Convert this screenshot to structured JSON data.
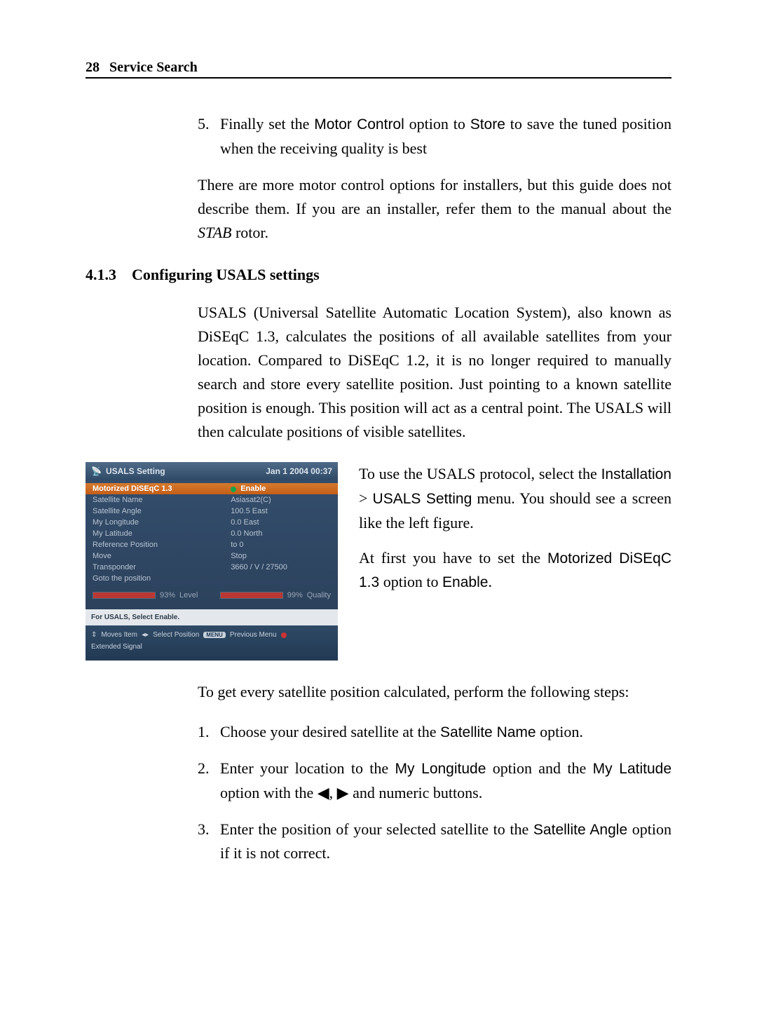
{
  "header": {
    "page_number": "28",
    "running_head": "Service Search"
  },
  "intro_list": {
    "item5_num": "5.",
    "item5_a": "Finally set the ",
    "item5_motor": "Motor Control",
    "item5_b": " option to ",
    "item5_store": "Store",
    "item5_c": " to save the tuned position when the receiving quality is best"
  },
  "para1_a": "There are more motor control options for installers, but this guide does not describe them. If you are an installer, refer them to the manual about the ",
  "para1_stab": "STAB",
  "para1_b": " rotor.",
  "section": {
    "num": "4.1.3",
    "title": "Configuring USALS settings"
  },
  "para2": "USALS (Universal Satellite Automatic Location System), also known as DiSEqC 1.3, calculates the positions of all available satellites from your location. Compared to DiSEqC 1.2, it is no longer required to manually search and store every satellite position. Just pointing to a known satellite position is enough. This position will act as a central point. The USALS will then calculate positions of visible satellites.",
  "side": {
    "p1_a": "To use the USALS protocol, select the ",
    "p1_install": "Installation",
    "p1_gt": " > ",
    "p1_usals": "USALS Setting",
    "p1_b": " menu. You should see a screen like the left figure.",
    "p2_a": "At first you have to set the ",
    "p2_opt": "Motorized DiSEqC 1.3",
    "p2_b": " option to ",
    "p2_en": "Enable",
    "p2_c": "."
  },
  "ui": {
    "title": "USALS Setting",
    "date": "Jan 1 2004 00:37",
    "rows": [
      {
        "label": "Motorized DiSEqC 1.3",
        "value": "Enable",
        "highlight": true,
        "dot": true
      },
      {
        "label": "Satellite Name",
        "value": "Asiasat2(C)"
      },
      {
        "label": "Satellite Angle",
        "value": "100.5 East"
      },
      {
        "label": "My Longitude",
        "value": "0.0 East"
      },
      {
        "label": "My Latitude",
        "value": "0.0 North"
      },
      {
        "label": "Reference Position",
        "value": "to 0"
      },
      {
        "label": "Move",
        "value": "Stop"
      },
      {
        "label": "Transponder",
        "value": "3660 / V / 27500"
      },
      {
        "label": "Goto the position",
        "value": ""
      }
    ],
    "meter1_pct": "93%",
    "meter1_lab": "Level",
    "meter2_pct": "99%",
    "meter2_lab": "Quality",
    "help": "For USALS, Select Enable.",
    "foot_updown": "Moves Item",
    "foot_lr": "Select Position",
    "foot_menu_pill": "MENU",
    "foot_menu": "Previous Menu",
    "foot_ext": "Extended Signal"
  },
  "para3": "To get every satellite position calculated, perform the following steps:",
  "steps": {
    "s1_num": "1.",
    "s1_a": "Choose your desired satellite at the ",
    "s1_opt": "Satellite Name",
    "s1_b": " option.",
    "s2_num": "2.",
    "s2_a": "Enter your location to the ",
    "s2_long": "My Longitude",
    "s2_b": " option and the ",
    "s2_lat": "My Latitude",
    "s2_c": " option with the ",
    "s2_tri_l": "◀",
    "s2_d": ", ",
    "s2_tri_r": "▶",
    "s2_e": " and numeric buttons.",
    "s3_num": "3.",
    "s3_a": "Enter the position of your selected satellite to the ",
    "s3_opt": "Satellite Angle",
    "s3_b": " option if it is not correct."
  }
}
